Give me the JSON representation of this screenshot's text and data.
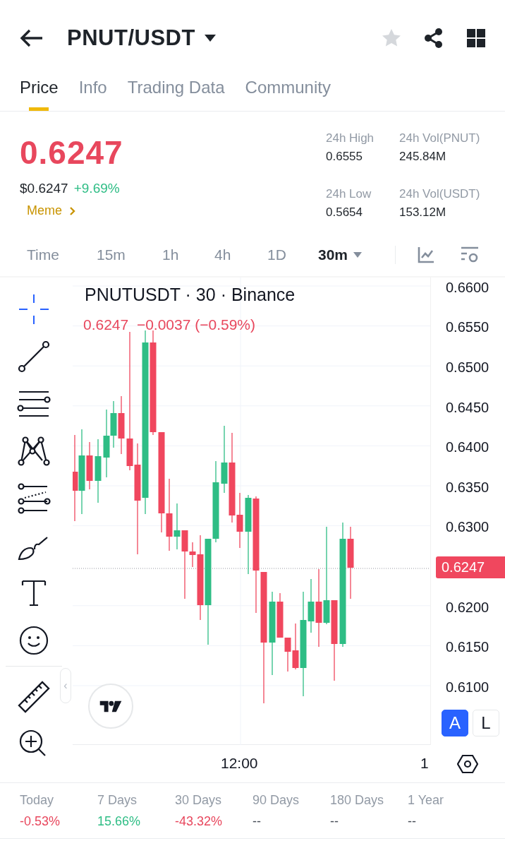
{
  "header": {
    "title": "PNUT/USDT",
    "favorite": false
  },
  "tabs": [
    {
      "label": "Price",
      "selected": true
    },
    {
      "label": "Info",
      "selected": false
    },
    {
      "label": "Trading Data",
      "selected": false
    },
    {
      "label": "Community",
      "selected": false
    }
  ],
  "price": {
    "last": "0.6247",
    "usd": "$0.6247",
    "change": "+9.69%",
    "tag": "Meme"
  },
  "stats": [
    {
      "label": "24h High",
      "value": "0.6555"
    },
    {
      "label": "24h Vol(PNUT)",
      "value": "245.84M"
    },
    {
      "label": "24h Low",
      "value": "0.5654"
    },
    {
      "label": "24h Vol(USDT)",
      "value": "153.12M"
    }
  ],
  "intervals": [
    {
      "label": "Time",
      "selected": false
    },
    {
      "label": "15m",
      "selected": false
    },
    {
      "label": "1h",
      "selected": false
    },
    {
      "label": "4h",
      "selected": false
    },
    {
      "label": "1D",
      "selected": false
    },
    {
      "label": "30m",
      "selected": true,
      "kind": "dropdown"
    }
  ],
  "chart": {
    "title": "PNUTUSDT · 30 · Binance",
    "ohlc": "0.6247  −0.0037 (−0.59%)",
    "y_axis": [
      {
        "kind": "tick",
        "text": "0.6600"
      },
      {
        "kind": "tick",
        "text": "0.6550"
      },
      {
        "kind": "tick",
        "text": "0.6500"
      },
      {
        "kind": "tick",
        "text": "0.6450"
      },
      {
        "kind": "tick",
        "text": "0.6400"
      },
      {
        "kind": "tick",
        "text": "0.6350"
      },
      {
        "kind": "tick",
        "text": "0.6300"
      },
      {
        "kind": "price",
        "text": "0.6247"
      },
      {
        "kind": "tick",
        "text": "0.6200"
      },
      {
        "kind": "tick",
        "text": "0.6150"
      },
      {
        "kind": "tick",
        "text": "0.6100"
      }
    ],
    "x_axis": [
      "12:00",
      "1"
    ],
    "scale_modes": [
      {
        "label": "A",
        "selected": true
      },
      {
        "label": "L",
        "selected": false
      }
    ],
    "handle": "‹"
  },
  "performance": [
    {
      "label": "Today",
      "value": "-0.53%",
      "color": "#e8475d"
    },
    {
      "label": "7 Days",
      "value": "15.66%",
      "color": "#2ebd85"
    },
    {
      "label": "30 Days",
      "value": "-43.32%",
      "color": "#e8475d"
    },
    {
      "label": "90 Days",
      "value": "--",
      "color": "#474d57"
    },
    {
      "label": "180 Days",
      "value": "--",
      "color": "#474d57"
    },
    {
      "label": "1 Year",
      "value": "--",
      "color": "#474d57"
    }
  ]
}
